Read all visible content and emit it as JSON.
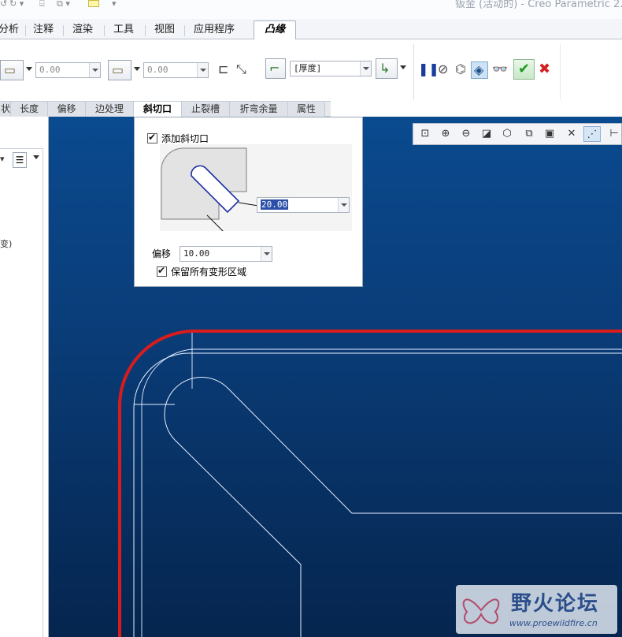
{
  "window": {
    "title": "钣金 (活动的) - Creo Parametric 2."
  },
  "menu": {
    "tabs": [
      "分析",
      "注释",
      "渲染",
      "工具",
      "视图",
      "应用程序"
    ],
    "active_tab": "凸缘"
  },
  "ribbon": {
    "length_value_1": "0.00",
    "length_value_2": "0.00",
    "thickness_option": "[厚度]",
    "ok_icon": "checkmark-icon",
    "cancel_icon": "x-icon"
  },
  "subtabs": {
    "items": [
      "状",
      "长度",
      "偏移",
      "边处理",
      "斜切口",
      "止裂槽",
      "折弯余量",
      "属性"
    ],
    "active": "斜切口"
  },
  "miter_panel": {
    "add_miter_label": "添加斜切口",
    "add_miter_checked": true,
    "width_value": "20.00",
    "offset_label": "偏移",
    "offset_value": "10.00",
    "keep_deform_label": "保留所有变形区域",
    "keep_deform_checked": true
  },
  "left_panel": {
    "fragment": "变)"
  },
  "colors": {
    "viewport_top": "#0a4a8f",
    "viewport_bottom": "#05254e",
    "edge_highlight": "#d81c1c",
    "accent_ok": "#2aa82a"
  },
  "watermark": {
    "title": "野火论坛",
    "url": "www.proewildfire.cn"
  }
}
